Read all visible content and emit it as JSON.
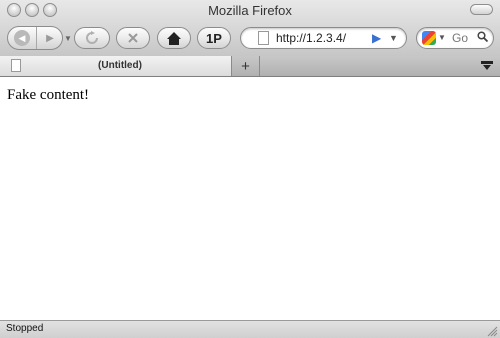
{
  "window": {
    "title": "Mozilla Firefox"
  },
  "toolbar": {
    "back_icon": "back-arrow-icon",
    "forward_icon": "forward-arrow-icon",
    "reload_icon": "reload-icon",
    "stop_icon": "stop-icon",
    "home_icon": "home-icon",
    "onep_label": "1P"
  },
  "urlbar": {
    "value": "http://1.2.3.4/"
  },
  "search": {
    "placeholder": "Go",
    "engine_icon": "google-icon"
  },
  "tabs": [
    {
      "label": "(Untitled)"
    }
  ],
  "newtab": {
    "label": "+"
  },
  "content": {
    "text": "Fake content!"
  },
  "status": {
    "text": "Stopped"
  },
  "colors": {
    "go_arrow": "#3b6fd1",
    "chrome": "#d6d6d6"
  }
}
